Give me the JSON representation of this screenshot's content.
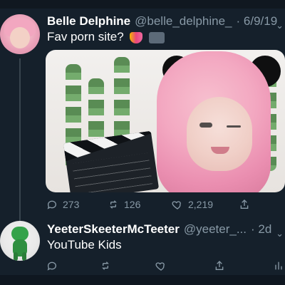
{
  "tweet1": {
    "author": {
      "display_name": "Belle Delphine",
      "handle": "@belle_delphine_",
      "date": "· 6/9/19"
    },
    "text": "Fav porn site?",
    "emoji": [
      "heart-on-fire-emoji",
      "movie-camera-emoji"
    ],
    "media": {
      "alt_visible": ""
    },
    "actions": {
      "replies": "273",
      "retweets": "126",
      "likes": "2,219"
    }
  },
  "tweet2": {
    "author": {
      "display_name": "YeeterSkeeterMcTeeter",
      "handle": "@yeeter_...",
      "date": "· 2d"
    },
    "text": "YouTube Kids"
  },
  "icons": {
    "reply": "reply-icon",
    "retweet": "retweet-icon",
    "like": "heart-icon",
    "share": "share-icon",
    "more": "chevron-down-icon",
    "analytics": "analytics-icon"
  },
  "colors": {
    "background": "#15202b",
    "secondary_text": "#8899a6",
    "thread_line": "#38444d"
  }
}
